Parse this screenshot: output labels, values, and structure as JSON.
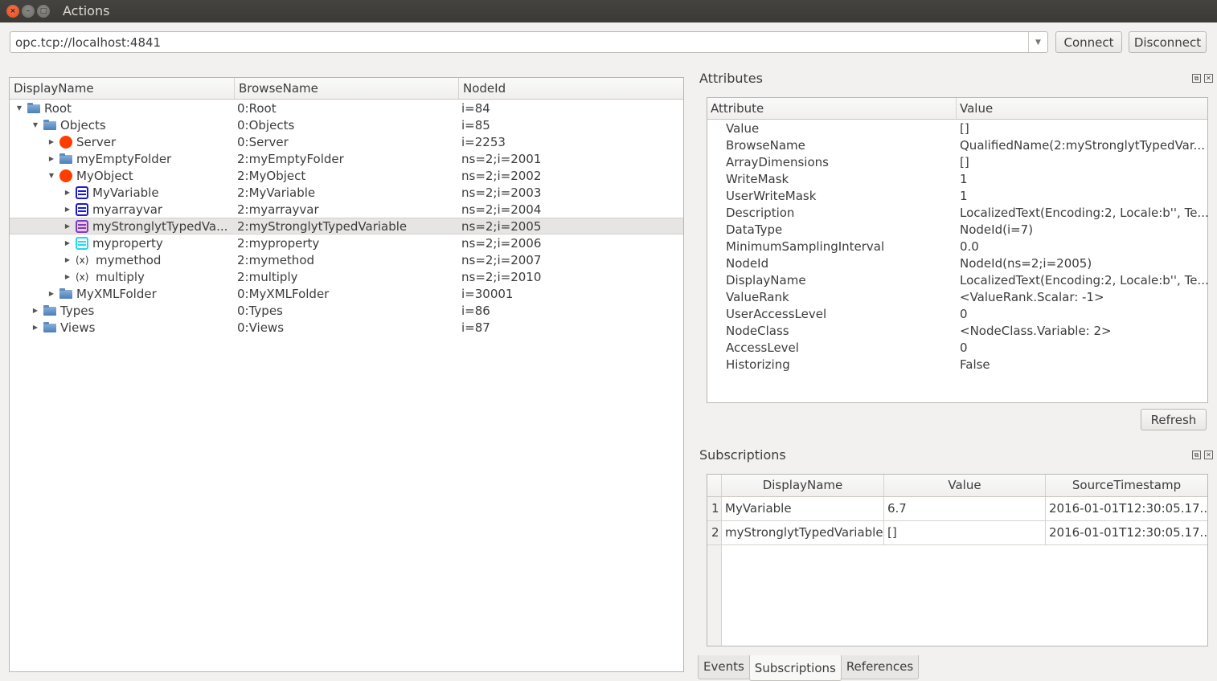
{
  "window": {
    "title": "Actions",
    "controls": [
      "close",
      "minimize",
      "maximize"
    ]
  },
  "connection": {
    "url_value": "opc.tcp://localhost:4841",
    "connect_label": "Connect",
    "disconnect_label": "Disconnect"
  },
  "tree": {
    "columns": [
      "DisplayName",
      "BrowseName",
      "NodeId"
    ],
    "rows": [
      {
        "display": "Root",
        "browse": "0:Root",
        "nodeid": "i=84",
        "depth": 0,
        "expander": "expanded",
        "icon": "folder"
      },
      {
        "display": "Objects",
        "browse": "0:Objects",
        "nodeid": "i=85",
        "depth": 1,
        "expander": "expanded",
        "icon": "folder"
      },
      {
        "display": "Server",
        "browse": "0:Server",
        "nodeid": "i=2253",
        "depth": 2,
        "expander": "collapsed",
        "icon": "object"
      },
      {
        "display": "myEmptyFolder",
        "browse": "2:myEmptyFolder",
        "nodeid": "ns=2;i=2001",
        "depth": 2,
        "expander": "collapsed",
        "icon": "folder"
      },
      {
        "display": "MyObject",
        "browse": "2:MyObject",
        "nodeid": "ns=2;i=2002",
        "depth": 2,
        "expander": "expanded",
        "icon": "object"
      },
      {
        "display": "MyVariable",
        "browse": "2:MyVariable",
        "nodeid": "ns=2;i=2003",
        "depth": 3,
        "expander": "collapsed",
        "icon": "variable"
      },
      {
        "display": "myarrayvar",
        "browse": "2:myarrayvar",
        "nodeid": "ns=2;i=2004",
        "depth": 3,
        "expander": "collapsed",
        "icon": "variable"
      },
      {
        "display": "myStronglytTypedVa...",
        "browse": "2:myStronglytTypedVariable",
        "nodeid": "ns=2;i=2005",
        "depth": 3,
        "expander": "collapsed",
        "icon": "variable-typed",
        "selected": true
      },
      {
        "display": "myproperty",
        "browse": "2:myproperty",
        "nodeid": "ns=2;i=2006",
        "depth": 3,
        "expander": "collapsed",
        "icon": "property"
      },
      {
        "display": "mymethod",
        "browse": "2:mymethod",
        "nodeid": "ns=2;i=2007",
        "depth": 3,
        "expander": "collapsed",
        "icon": "method"
      },
      {
        "display": "multiply",
        "browse": "2:multiply",
        "nodeid": "ns=2;i=2010",
        "depth": 3,
        "expander": "collapsed",
        "icon": "method"
      },
      {
        "display": "MyXMLFolder",
        "browse": "0:MyXMLFolder",
        "nodeid": "i=30001",
        "depth": 2,
        "expander": "collapsed",
        "icon": "folder"
      },
      {
        "display": "Types",
        "browse": "0:Types",
        "nodeid": "i=86",
        "depth": 1,
        "expander": "collapsed",
        "icon": "folder"
      },
      {
        "display": "Views",
        "browse": "0:Views",
        "nodeid": "i=87",
        "depth": 1,
        "expander": "collapsed",
        "icon": "folder"
      }
    ]
  },
  "attributes": {
    "title": "Attributes",
    "columns": [
      "Attribute",
      "Value"
    ],
    "rows": [
      {
        "key": "Value",
        "value": "[]"
      },
      {
        "key": "BrowseName",
        "value": "QualifiedName(2:myStronglytTypedVar..."
      },
      {
        "key": "ArrayDimensions",
        "value": "[]"
      },
      {
        "key": "WriteMask",
        "value": "1"
      },
      {
        "key": "UserWriteMask",
        "value": "1"
      },
      {
        "key": "Description",
        "value": "LocalizedText(Encoding:2, Locale:b'', Te..."
      },
      {
        "key": "DataType",
        "value": "NodeId(i=7)"
      },
      {
        "key": "MinimumSamplingInterval",
        "value": "0.0"
      },
      {
        "key": "NodeId",
        "value": "NodeId(ns=2;i=2005)"
      },
      {
        "key": "DisplayName",
        "value": "LocalizedText(Encoding:2, Locale:b'', Te..."
      },
      {
        "key": "ValueRank",
        "value": "<ValueRank.Scalar: -1>"
      },
      {
        "key": "UserAccessLevel",
        "value": "0"
      },
      {
        "key": "NodeClass",
        "value": "<NodeClass.Variable: 2>"
      },
      {
        "key": "AccessLevel",
        "value": "0"
      },
      {
        "key": "Historizing",
        "value": "False"
      }
    ],
    "refresh_label": "Refresh"
  },
  "subscriptions": {
    "title": "Subscriptions",
    "columns": [
      "DisplayName",
      "Value",
      "SourceTimestamp"
    ],
    "rows": [
      {
        "num": "1",
        "display": "MyVariable",
        "value": "6.7",
        "timestamp": "2016-01-01T12:30:05.17..."
      },
      {
        "num": "2",
        "display": "myStronglytTypedVariable",
        "value": "[]",
        "timestamp": "2016-01-01T12:30:05.17..."
      }
    ]
  },
  "bottom_tabs": [
    {
      "label": "Events",
      "active": false
    },
    {
      "label": "Subscriptions",
      "active": true
    },
    {
      "label": "References",
      "active": false
    }
  ],
  "colors": {
    "object_icon": "#fd3e00",
    "variable_icon": "#1a1ad6",
    "variable_typed_icon": "#7a3fc4",
    "property_icon": "#22d8f0",
    "folder_icon": "#4a7fb8",
    "selection": "#e6e5e3"
  }
}
